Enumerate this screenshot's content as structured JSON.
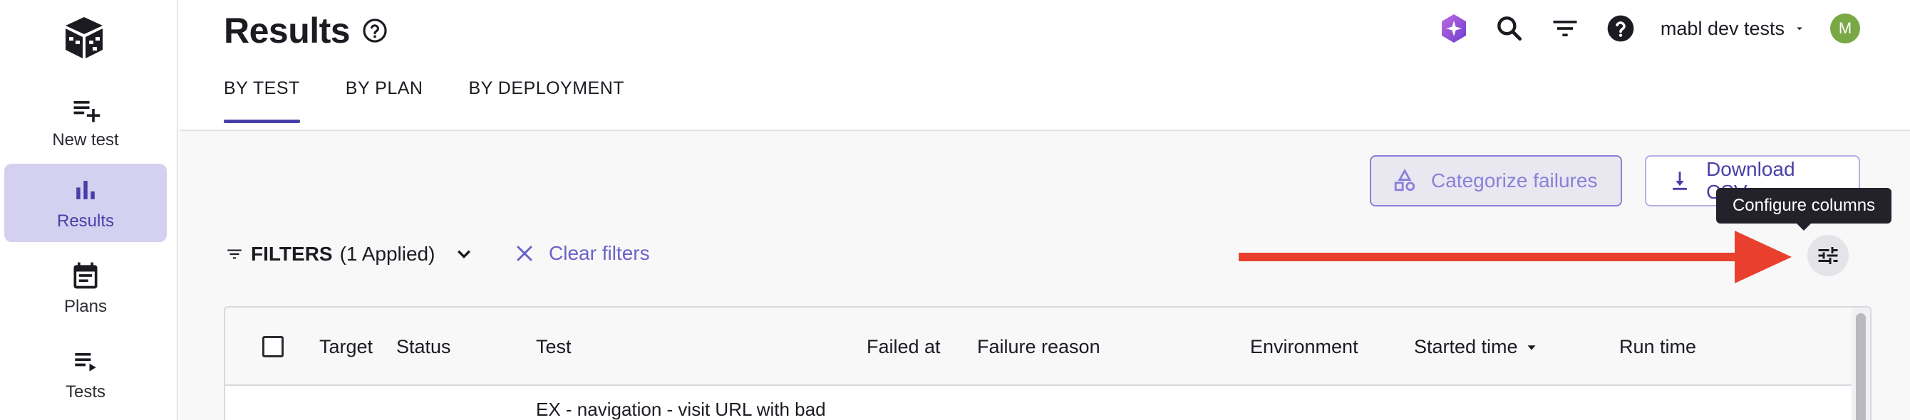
{
  "sidebar": {
    "items": [
      {
        "label": "New test",
        "icon": "playlist-add-icon"
      },
      {
        "label": "Results",
        "icon": "bar-chart-icon",
        "active": true
      },
      {
        "label": "Plans",
        "icon": "calendar-icon"
      },
      {
        "label": "Tests",
        "icon": "playlist-play-icon"
      }
    ]
  },
  "header": {
    "title": "Results",
    "tabs": [
      "BY TEST",
      "BY PLAN",
      "BY DEPLOYMENT"
    ],
    "active_tab": "BY TEST",
    "workspace": "mabl dev tests",
    "avatar_initial": "M"
  },
  "toolbar": {
    "categorize_label": "Categorize failures",
    "download_label": "Download CSV",
    "tooltip": "Configure columns",
    "filters_label": "FILTERS",
    "filters_applied": "(1 Applied)",
    "clear_filters_label": "Clear filters"
  },
  "table": {
    "columns": [
      "Target",
      "Status",
      "Test",
      "Failed at",
      "Failure reason",
      "Environment",
      "Started time",
      "Run time"
    ],
    "first_row_test": "EX - navigation - visit URL with bad"
  },
  "colors": {
    "accent": "#4a3fa8",
    "active_nav_bg": "#d4d0f0",
    "annotation_arrow": "#e8402c",
    "avatar": "#7aa845"
  }
}
